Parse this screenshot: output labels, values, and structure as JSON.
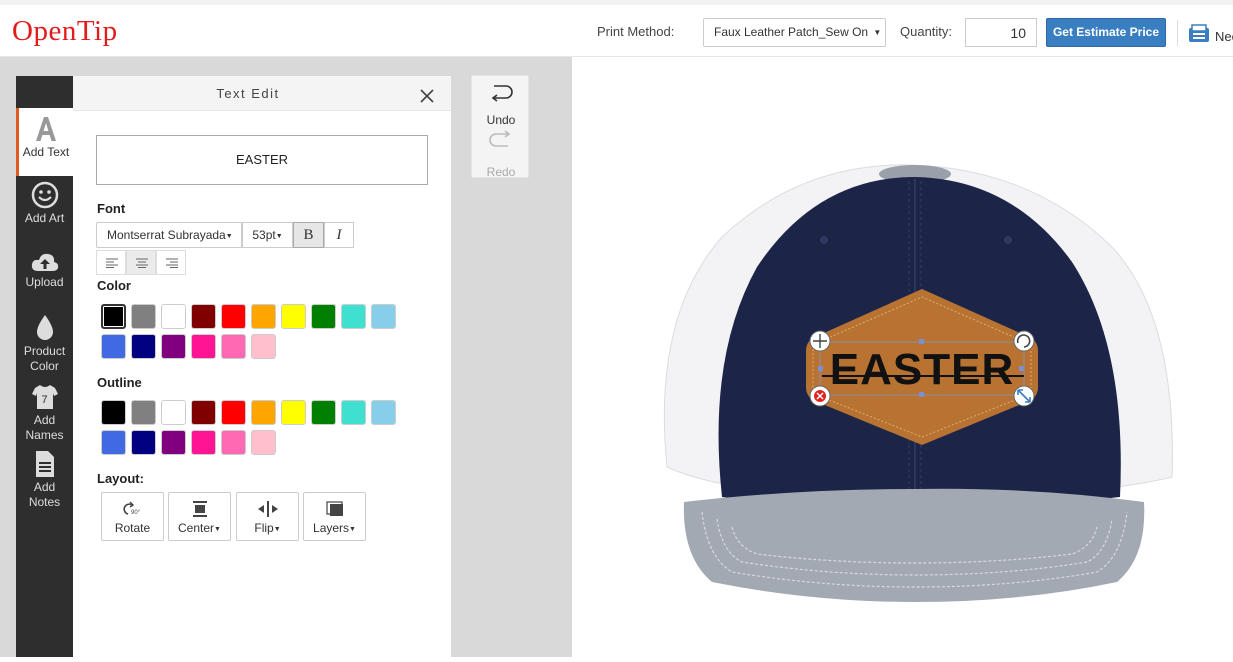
{
  "header": {
    "logo": "OpenTip",
    "print_method_label": "Print Method:",
    "print_method_value": "Faux Leather Patch_Sew On",
    "quantity_label": "Quantity:",
    "quantity_value": "10",
    "estimate_button": "Get Estimate Price",
    "need_label": "Nee"
  },
  "toolbar": {
    "items": [
      {
        "label": "Add Text"
      },
      {
        "label": "Add Art"
      },
      {
        "label": "Upload"
      },
      {
        "label_line1": "Product",
        "label_line2": "Color"
      },
      {
        "label_line1": "Add",
        "label_line2": "Names"
      },
      {
        "label_line1": "Add",
        "label_line2": "Notes"
      }
    ],
    "names_icon_number": "7",
    "active_accent": "#e05a22"
  },
  "panel": {
    "title": "Text Edit",
    "text_value": "EASTER",
    "font_label": "Font",
    "font_value": "Montserrat Subrayada",
    "size_value": "53pt",
    "bold_label": "B",
    "italic_label": "I",
    "color_label": "Color",
    "outline_label": "Outline",
    "layout_label": "Layout:",
    "layout_buttons": {
      "rotate": "Rotate",
      "center": "Center",
      "flip": "Flip",
      "layers": "Layers"
    },
    "rotate_icon_text": "90°"
  },
  "palette": [
    "#000000",
    "#808080",
    "#ffffff",
    "#800000",
    "#ff0000",
    "#ffa500",
    "#ffff00",
    "#008000",
    "#40e0d0",
    "#87ceeb",
    "#4169e1",
    "#000080",
    "#800080",
    "#ff1493",
    "#ff69b4",
    "#ffc0cb"
  ],
  "history": {
    "undo": "Undo",
    "redo": "Redo"
  },
  "design": {
    "patch_text": "EASTER",
    "patch_color": "#b87333",
    "hat_front": "#1c2447",
    "hat_brim": "#a3a9b3"
  }
}
